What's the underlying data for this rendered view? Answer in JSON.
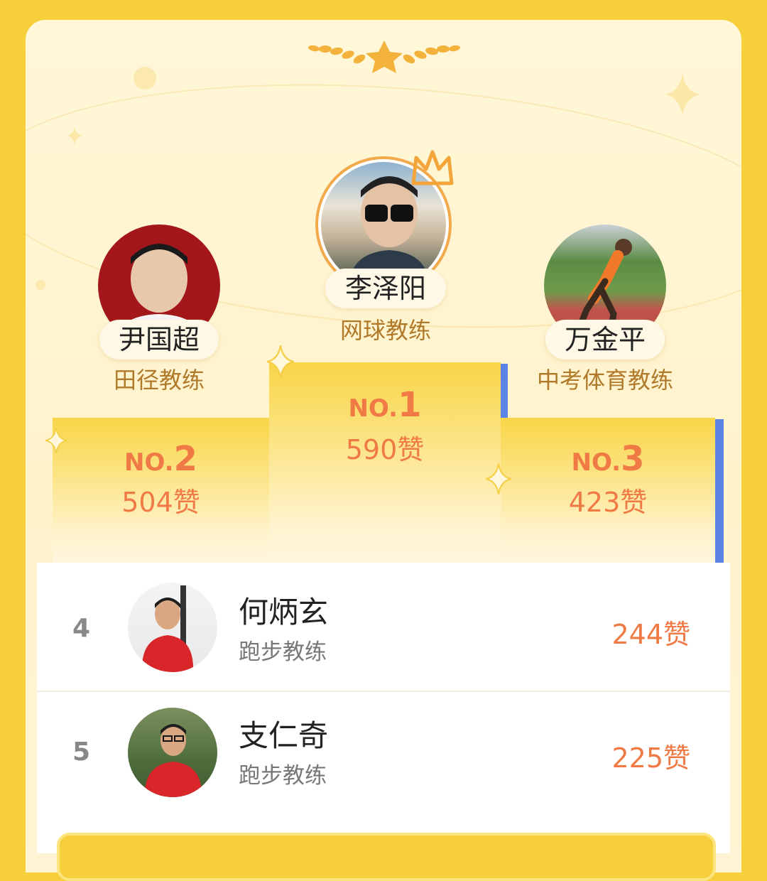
{
  "podium": {
    "first": {
      "name": "李泽阳",
      "role": "网球教练",
      "no_prefix": "NO.",
      "no_num": "1",
      "likes": "590赞"
    },
    "second": {
      "name": "尹国超",
      "role": "田径教练",
      "no_prefix": "NO.",
      "no_num": "2",
      "likes": "504赞"
    },
    "third": {
      "name": "万金平",
      "role": "中考体育教练",
      "no_prefix": "NO.",
      "no_num": "3",
      "likes": "423赞"
    }
  },
  "list": [
    {
      "rank": "4",
      "name": "何炳玄",
      "role": "跑步教练",
      "likes": "244赞"
    },
    {
      "rank": "5",
      "name": "支仁奇",
      "role": "跑步教练",
      "likes": "225赞"
    }
  ],
  "colors": {
    "background": "#f7cf3b",
    "accent": "#f07a45",
    "ring": "#f2a94a",
    "role_text": "#b07a2a"
  }
}
